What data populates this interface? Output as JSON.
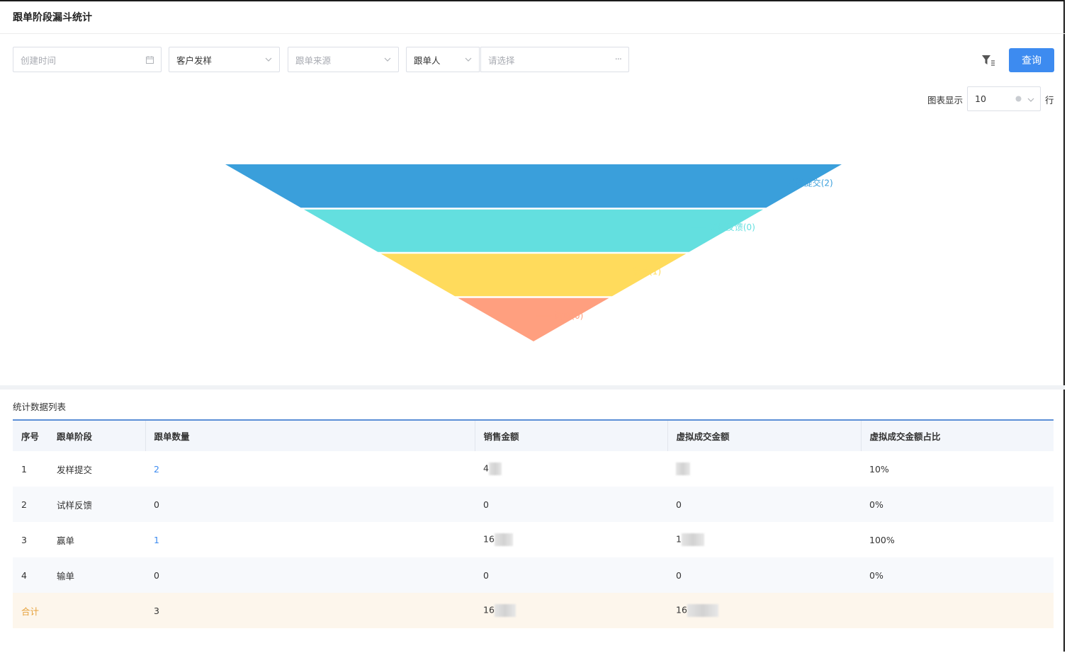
{
  "page": {
    "title": "跟单阶段漏斗统计"
  },
  "filters": {
    "date_placeholder": "创建时间",
    "stage_value": "客户发样",
    "source_placeholder": "跟单来源",
    "person_value": "跟单人",
    "choose_placeholder": "请选择",
    "more": "···"
  },
  "toolbar": {
    "query_label": "查询"
  },
  "display": {
    "label": "图表显示",
    "rows_value": "10",
    "suffix": "行"
  },
  "chart_data": {
    "type": "funnel",
    "stages": [
      {
        "name": "发样提交",
        "value": 2,
        "label": "发样提交(2)",
        "color": "#3a9fdb"
      },
      {
        "name": "试样反馈",
        "value": 0,
        "label": "试样反馈(0)",
        "color": "#63dfdf"
      },
      {
        "name": "赢单",
        "value": 1,
        "label": "赢单(1)",
        "color": "#ffdb5c"
      },
      {
        "name": "输单",
        "value": 0,
        "label": "输单(0)",
        "color": "#ff9f7f"
      }
    ]
  },
  "list": {
    "title": "统计数据列表",
    "columns": [
      "序号",
      "跟单阶段",
      "跟单数量",
      "销售金额",
      "虚拟成交金额",
      "虚拟成交金额占比"
    ],
    "rows": [
      {
        "no": "1",
        "stage": "发样提交",
        "count": "2",
        "sales": "4",
        "virtual": "",
        "ratio": "10%"
      },
      {
        "no": "2",
        "stage": "试样反馈",
        "count": "0",
        "sales": "0",
        "virtual": "0",
        "ratio": "0%"
      },
      {
        "no": "3",
        "stage": "赢单",
        "count": "1",
        "sales": "16",
        "virtual": "1",
        "ratio": "100%"
      },
      {
        "no": "4",
        "stage": "输单",
        "count": "0",
        "sales": "0",
        "virtual": "0",
        "ratio": "0%"
      }
    ],
    "total": {
      "label": "合计",
      "count": "3",
      "sales": "16",
      "virtual": "16"
    }
  }
}
